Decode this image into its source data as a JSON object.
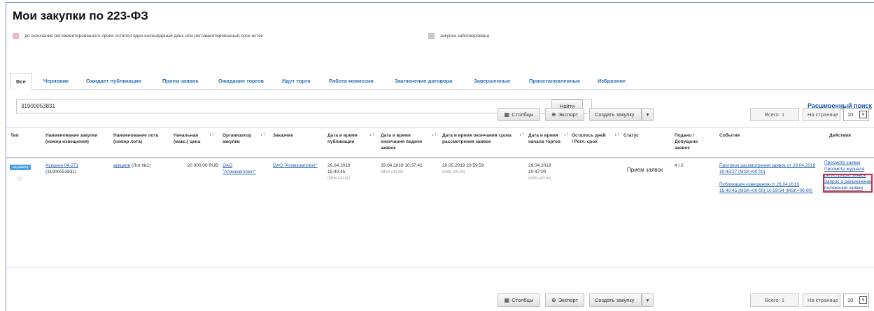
{
  "page": {
    "title": "Мои закупки по 223-ФЗ"
  },
  "legend": [
    {
      "text": "до окончания регламентированного срока остался один календарный день или регламентированный срок истек",
      "color": "#f4b7c5"
    },
    {
      "text": "закупка заблокирована",
      "color": "#c8c8c8"
    }
  ],
  "tabs": [
    "Все",
    "Черновик",
    "Ожидает публикации",
    "Прием заявок",
    "Ожидание торгов",
    "Идут торги",
    "Работа комиссии",
    "Заключение договора",
    "Завершенные",
    "Приостановленные",
    "Избранное"
  ],
  "search": {
    "value": "31900053831",
    "button": "Найти",
    "advanced": "Расширенный поиск"
  },
  "toolbar": {
    "columns": "Столбцы",
    "export": "Экспорт",
    "create": "Создать закупку",
    "total": "Всего: 1",
    "per_page_label": "На странице",
    "per_page": "10"
  },
  "columns": {
    "type": "Тип",
    "name": "Наименование закупки (номер извещения)",
    "lot": "Наименование лота (номер лота)",
    "price": "Начальная (макс.) цена",
    "organizer": "Организатор закупки",
    "customer": "Заказчик",
    "pub_date": "Дата и время публикации",
    "end_date": "Дата и время окончания подачи заявок",
    "review_date": "Дата и время окончания срока рассмотрения заявок",
    "auction_date": "Дата и время начала торгов",
    "days_left": "Осталось дней / Регл. срок",
    "status": "Статус",
    "submitted": "Подано / Допущено заявок",
    "events": "События",
    "actions": "Действия"
  },
  "row": {
    "type_badge": "ЭА (ОМСП)",
    "name": "Аукцион 04-271",
    "number": "(31900053831)",
    "lot_link": "аукцион",
    "lot_num": "(Лот №1)",
    "price": "20 000.00 RUB",
    "organizer": "ОАО \"Атомкомплект\"",
    "customer": "ОАО \"Атомкомплект\"",
    "pub_date": "26.04.2019",
    "pub_time": "15:40:45",
    "pub_tz": "(MSK+00:00)",
    "end_date": "29.04.2019 10:37:42",
    "end_tz": "(MSK+00:00)",
    "review_date": "20.05.2019 20:59:59",
    "review_tz": "(MSK+00:00)",
    "auction_date": "29.04.2019",
    "auction_time": "10:47:00",
    "auction_tz": "(MSK+00:00)",
    "status": "Прием заявок",
    "submitted": "4 / 2",
    "events": [
      "Протокол рассмотрения заявок от 29.04.2019 10:43:27 (MSK+00:00)",
      "Публикация извещения от 26.04.2019 15:40:45 (MSK+00:00) 10:59:34 (MSK+00:00)"
    ],
    "actions": [
      "Просмотр заявок",
      "Просмотр журнала регистрации заявок",
      "Запрос о разъяснении положений заявки"
    ]
  }
}
